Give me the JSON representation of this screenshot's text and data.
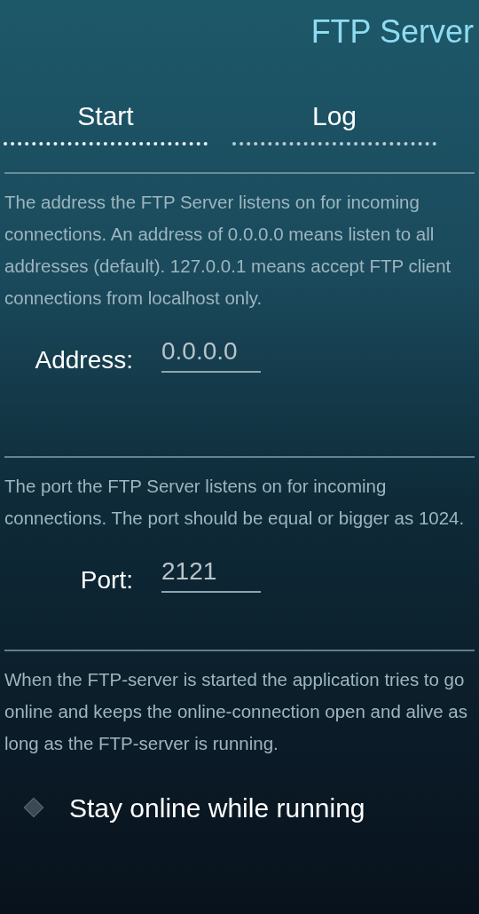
{
  "title": "FTP Server",
  "tabs": [
    {
      "label": "Start",
      "selected": true
    },
    {
      "label": "Log",
      "selected": false
    }
  ],
  "sections": [
    {
      "kind": "field",
      "description": "The address the FTP Server listens on for incoming connections. An address of 0.0.0.0 means listen to all addresses (default). 127.0.0.1 means accept FTP client connections from localhost only.",
      "label": "Address:",
      "value": "0.0.0.0"
    },
    {
      "kind": "field",
      "description": "The port the FTP Server listens on for incoming connections. The port should be equal or bigger as 1024.",
      "label": "Port:",
      "value": "2121"
    },
    {
      "kind": "checkbox",
      "description": "When the FTP-server is started the application tries to go online and keeps the online-connection open and alive as long as the FTP-server is running.",
      "label": "Stay online while running",
      "checked": false
    }
  ]
}
